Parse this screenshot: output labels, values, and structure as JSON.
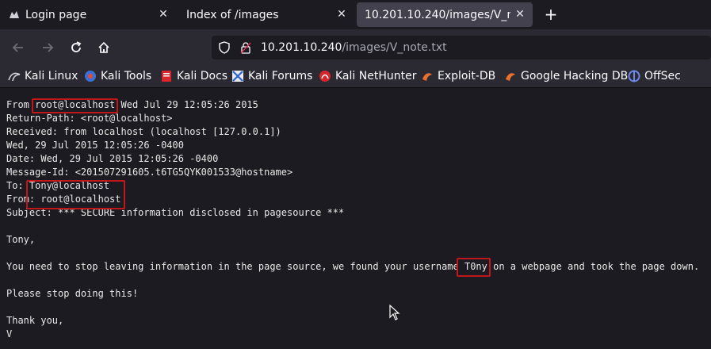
{
  "tabs": [
    {
      "title": "Login page",
      "icon": "kali-dragon-icon",
      "active": false
    },
    {
      "title": "Index of /images",
      "icon": "none",
      "active": false
    },
    {
      "title": "10.201.10.240/images/V_note.txt",
      "icon": "none",
      "active": true
    }
  ],
  "navbar": {
    "url_host": "10.201.10.240",
    "url_path": "/images/V_note.txt"
  },
  "bookmarks": [
    {
      "label": "Kali Linux",
      "icon": "kali-dragon-icon"
    },
    {
      "label": "Kali Tools",
      "icon": "kali-tools-icon"
    },
    {
      "label": "Kali Docs",
      "icon": "kali-docs-icon"
    },
    {
      "label": "Kali Forums",
      "icon": "kali-forums-icon"
    },
    {
      "label": "Kali NetHunter",
      "icon": "nethunter-icon"
    },
    {
      "label": "Exploit-DB",
      "icon": "exploit-db-icon"
    },
    {
      "label": "Google Hacking DB",
      "icon": "ghdb-icon"
    },
    {
      "label": "OffSec",
      "icon": "offsec-icon"
    }
  ],
  "document": {
    "lines": [
      "From root@localhost Wed Jul 29 12:05:26 2015",
      "Return-Path: <root@localhost>",
      "Received: from localhost (localhost [127.0.0.1])",
      "Wed, 29 Jul 2015 12:05:26 -0400",
      "Date: Wed, 29 Jul 2015 12:05:26 -0400",
      "Message-Id: <201507291605.t6TG5QYK001533@hostname>",
      "To: Tony@localhost",
      "From: root@localhost",
      "Subject: *** SECURE information disclosed in pagesource ***",
      "",
      "Tony,",
      "",
      "You need to stop leaving information in the page source, we found your username T0ny on a webpage and took the page down.",
      "",
      "Please stop doing this!",
      "",
      "Thank you,",
      "V"
    ]
  },
  "colors": {
    "highlight": "#c0171b",
    "text": "#e8e8e8",
    "background": "#1c1b22"
  }
}
